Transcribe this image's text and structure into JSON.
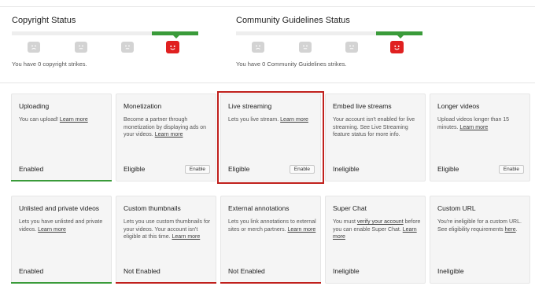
{
  "copyright": {
    "title": "Copyright Status",
    "strike_text": "You have 0 copyright strikes."
  },
  "community": {
    "title": "Community Guidelines Status",
    "strike_text": "You have 0 Community Guidelines strikes."
  },
  "colors": {
    "green": "#3a9b3a",
    "red": "#c0201c",
    "strike_active": "#e02020",
    "face_inactive": "#d3d3d3"
  },
  "features": [
    {
      "title": "Uploading",
      "desc": "You can upload!",
      "link": "Learn more",
      "status": "Enabled",
      "button": "",
      "bar": "green"
    },
    {
      "title": "Monetization",
      "desc": "Become a partner through monetization by displaying ads on your videos.",
      "link": "Learn more",
      "status": "Eligible",
      "button": "Enable",
      "bar": ""
    },
    {
      "title": "Live streaming",
      "desc": "Lets you live stream.",
      "link": "Learn more",
      "status": "Eligible",
      "button": "Enable",
      "bar": ""
    },
    {
      "title": "Embed live streams",
      "desc": "Your account isn't enabled for live streaming. See Live Streaming feature status for more info.",
      "link": "",
      "status": "Ineligible",
      "button": "",
      "bar": ""
    },
    {
      "title": "Longer videos",
      "desc": "Upload videos longer than 15 minutes.",
      "link": "Learn more",
      "status": "Eligible",
      "button": "Enable",
      "bar": ""
    },
    {
      "title": "Unlisted and private videos",
      "desc": "Lets you have unlisted and private videos.",
      "link": "Learn more",
      "status": "Enabled",
      "button": "",
      "bar": "green"
    },
    {
      "title": "Custom thumbnails",
      "desc": "Lets you use custom thumbnails for your videos. Your account isn't eligible at this time.",
      "link": "Learn more",
      "status": "Not Enabled",
      "button": "",
      "bar": "red"
    },
    {
      "title": "External annotations",
      "desc": "Lets you link annotations to external sites or merch partners.",
      "link": "Learn more",
      "status": "Not Enabled",
      "button": "",
      "bar": "red"
    },
    {
      "title": "Super Chat",
      "desc_pre": "You must",
      "link_inline": "verify your account",
      "desc": "before you can enable Super Chat.",
      "link": "Learn more",
      "status": "Ineligible",
      "button": "",
      "bar": ""
    },
    {
      "title": "Custom URL",
      "desc": "You're ineligible for a custom URL. See eligibility requirements",
      "link": "here",
      "link_suffix": ".",
      "status": "Ineligible",
      "button": "",
      "bar": ""
    }
  ]
}
